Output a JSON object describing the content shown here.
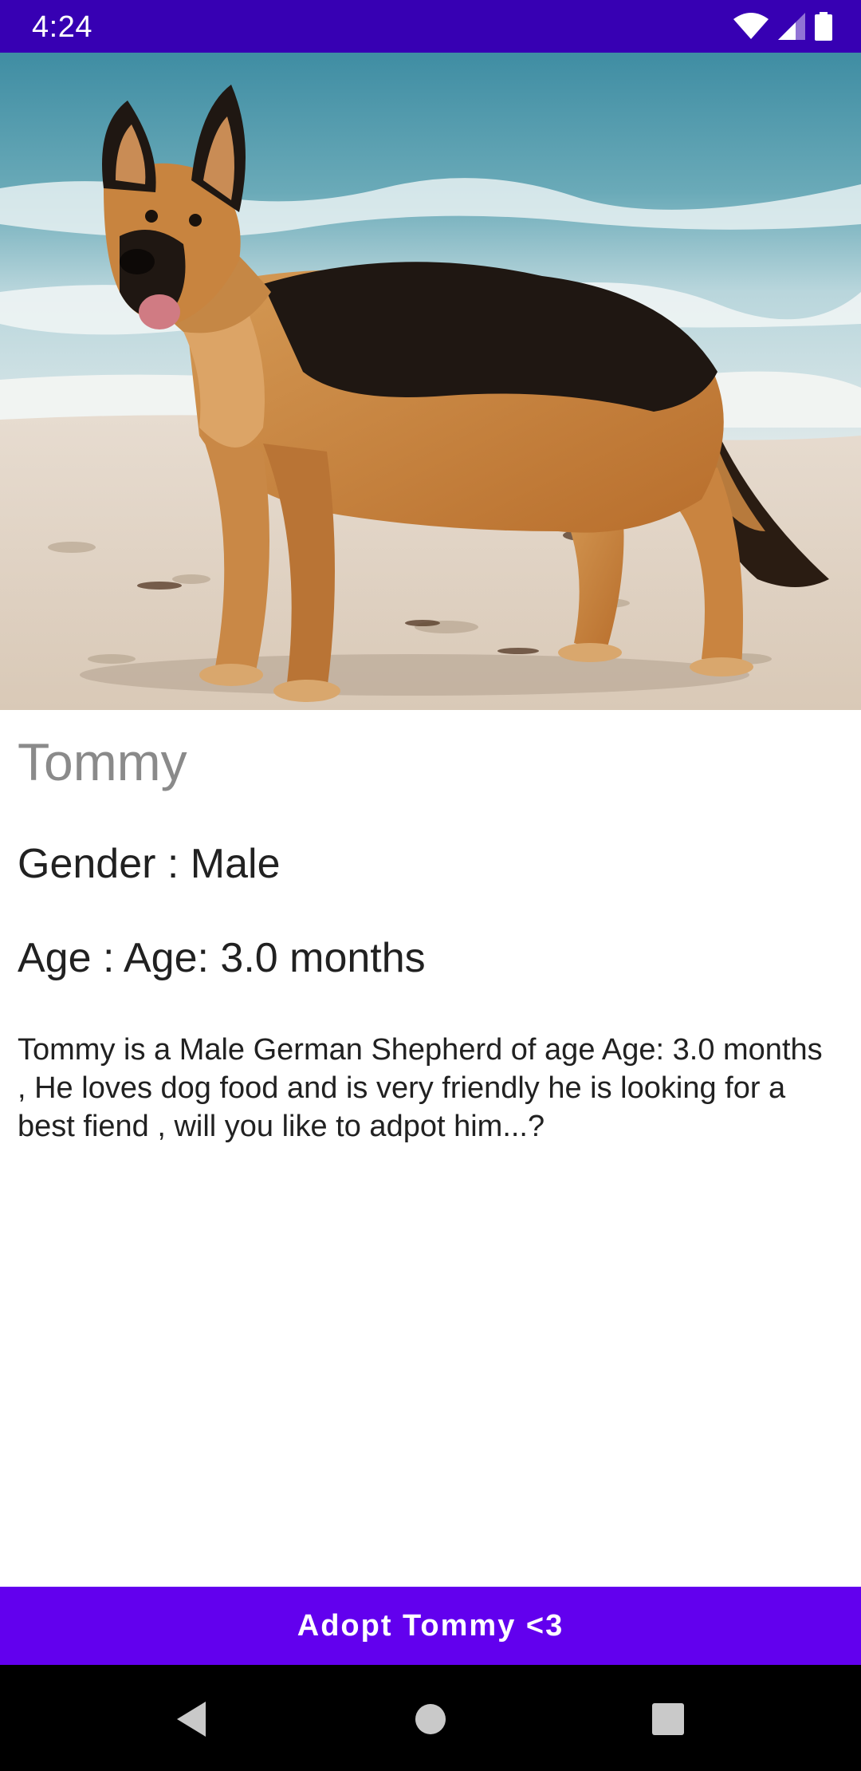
{
  "status_bar": {
    "time": "4:24",
    "icons": [
      "wifi-icon",
      "cell-signal-icon",
      "battery-icon"
    ],
    "background_color": "#3700b3"
  },
  "hero": {
    "image_subject": "German Shepherd dog standing on a beach"
  },
  "pet": {
    "name": "Tommy",
    "gender_line": "Gender : Male",
    "age_line": "Age : Age: 3.0 months",
    "description": "Tommy is a Male German Shepherd of age Age: 3.0 months , He loves dog food and is very friendly he is looking for a best fiend , will you like to adpot him...?"
  },
  "adopt_button": {
    "label": "Adopt Tommy <3",
    "color": "#6200ee"
  },
  "nav_bar": {
    "icons": [
      "back-icon",
      "home-icon",
      "recents-icon"
    ]
  }
}
